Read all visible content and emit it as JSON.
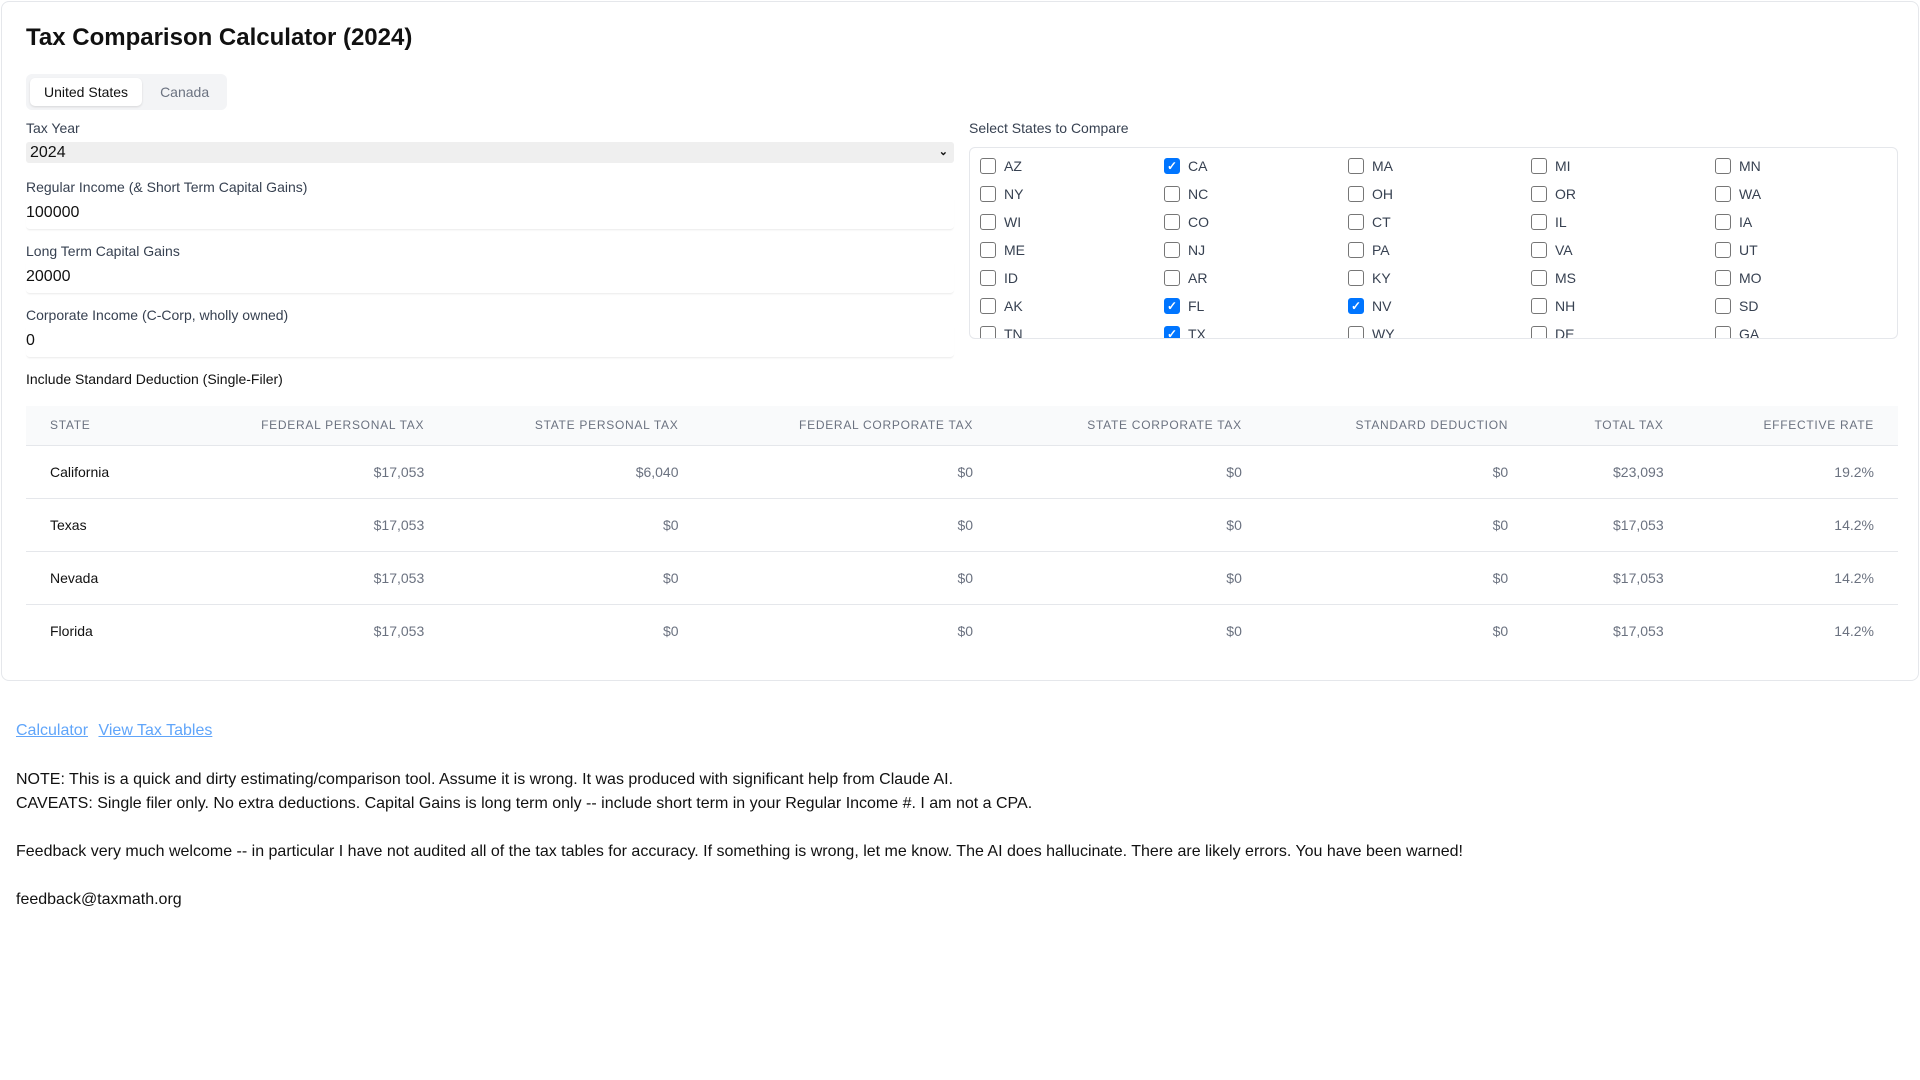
{
  "title": "Tax Comparison Calculator (2024)",
  "tabs": [
    {
      "label": "United States",
      "active": true
    },
    {
      "label": "Canada",
      "active": false
    }
  ],
  "form": {
    "tax_year_label": "Tax Year",
    "tax_year_value": "2024",
    "regular_income_label": "Regular Income (& Short Term Capital Gains)",
    "regular_income_value": "100000",
    "ltcg_label": "Long Term Capital Gains",
    "ltcg_value": "20000",
    "corporate_label": "Corporate Income (C-Corp, wholly owned)",
    "corporate_value": "0",
    "std_deduction_label": "Include Standard Deduction (Single-Filer)"
  },
  "states_label": "Select States to Compare",
  "states": [
    {
      "code": "AZ",
      "checked": false
    },
    {
      "code": "CA",
      "checked": true
    },
    {
      "code": "MA",
      "checked": false
    },
    {
      "code": "MI",
      "checked": false
    },
    {
      "code": "MN",
      "checked": false
    },
    {
      "code": "NY",
      "checked": false
    },
    {
      "code": "NC",
      "checked": false
    },
    {
      "code": "OH",
      "checked": false
    },
    {
      "code": "OR",
      "checked": false
    },
    {
      "code": "WA",
      "checked": false
    },
    {
      "code": "WI",
      "checked": false
    },
    {
      "code": "CO",
      "checked": false
    },
    {
      "code": "CT",
      "checked": false
    },
    {
      "code": "IL",
      "checked": false
    },
    {
      "code": "IA",
      "checked": false
    },
    {
      "code": "ME",
      "checked": false
    },
    {
      "code": "NJ",
      "checked": false
    },
    {
      "code": "PA",
      "checked": false
    },
    {
      "code": "VA",
      "checked": false
    },
    {
      "code": "UT",
      "checked": false
    },
    {
      "code": "ID",
      "checked": false
    },
    {
      "code": "AR",
      "checked": false
    },
    {
      "code": "KY",
      "checked": false
    },
    {
      "code": "MS",
      "checked": false
    },
    {
      "code": "MO",
      "checked": false
    },
    {
      "code": "AK",
      "checked": false
    },
    {
      "code": "FL",
      "checked": true
    },
    {
      "code": "NV",
      "checked": true
    },
    {
      "code": "NH",
      "checked": false
    },
    {
      "code": "SD",
      "checked": false
    },
    {
      "code": "TN",
      "checked": false
    },
    {
      "code": "TX",
      "checked": true
    },
    {
      "code": "WY",
      "checked": false
    },
    {
      "code": "DE",
      "checked": false
    },
    {
      "code": "GA",
      "checked": false
    }
  ],
  "table": {
    "headers": [
      "State",
      "Federal Personal Tax",
      "State Personal Tax",
      "Federal Corporate Tax",
      "State Corporate Tax",
      "Standard Deduction",
      "Total Tax",
      "Effective Rate"
    ],
    "rows": [
      [
        "California",
        "$17,053",
        "$6,040",
        "$0",
        "$0",
        "$0",
        "$23,093",
        "19.2%"
      ],
      [
        "Texas",
        "$17,053",
        "$0",
        "$0",
        "$0",
        "$0",
        "$17,053",
        "14.2%"
      ],
      [
        "Nevada",
        "$17,053",
        "$0",
        "$0",
        "$0",
        "$0",
        "$17,053",
        "14.2%"
      ],
      [
        "Florida",
        "$17,053",
        "$0",
        "$0",
        "$0",
        "$0",
        "$17,053",
        "14.2%"
      ]
    ]
  },
  "links": [
    "Calculator",
    "View Tax Tables"
  ],
  "notes": [
    "NOTE: This is a quick and dirty estimating/comparison tool. Assume it is wrong. It was produced with significant help from Claude AI.",
    "CAVEATS: Single filer only. No extra deductions. Capital Gains is long term only -- include short term in your Regular Income #. I am not a CPA.",
    "",
    "Feedback very much welcome -- in particular I have not audited all of the tax tables for accuracy. If something is wrong, let me know. The AI does hallucinate. There are likely errors. You have been warned!",
    "",
    "feedback@taxmath.org"
  ],
  "colors": {
    "checkbox_accent": "#0075ff",
    "link": "#60a5fa",
    "table_header_bg": "#f9fafb"
  }
}
